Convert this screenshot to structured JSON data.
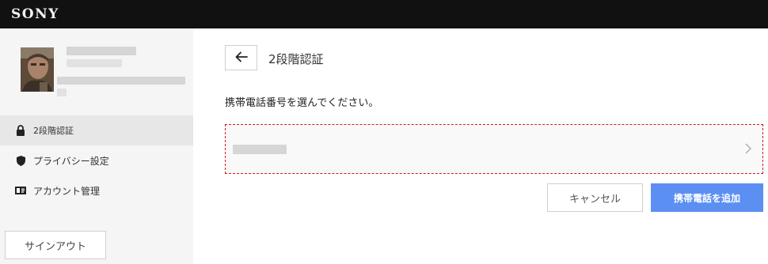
{
  "header": {
    "brand": "SONY"
  },
  "sidebar": {
    "avatar_icon": "user-avatar-photo",
    "items": [
      {
        "label": "2段階認証",
        "icon": "lock-icon",
        "active": true
      },
      {
        "label": "プライバシー設定",
        "icon": "shield-icon",
        "active": false
      },
      {
        "label": "アカウント管理",
        "icon": "id-card-icon",
        "active": false
      }
    ],
    "signout_label": "サインアウト"
  },
  "main": {
    "back_icon": "arrow-left-icon",
    "title": "2段階認証",
    "instruction": "携帯電話番号を選んでください。",
    "phone_item_icon": "chevron-right-icon",
    "cancel_label": "キャンセル",
    "add_label": "携帯電話を追加"
  },
  "colors": {
    "topbar": "#111111",
    "sidebar_bg": "#f5f5f5",
    "active_item_bg": "#e7e7e7",
    "primary_button": "#5b8ff2",
    "selection_border": "#d01818"
  }
}
